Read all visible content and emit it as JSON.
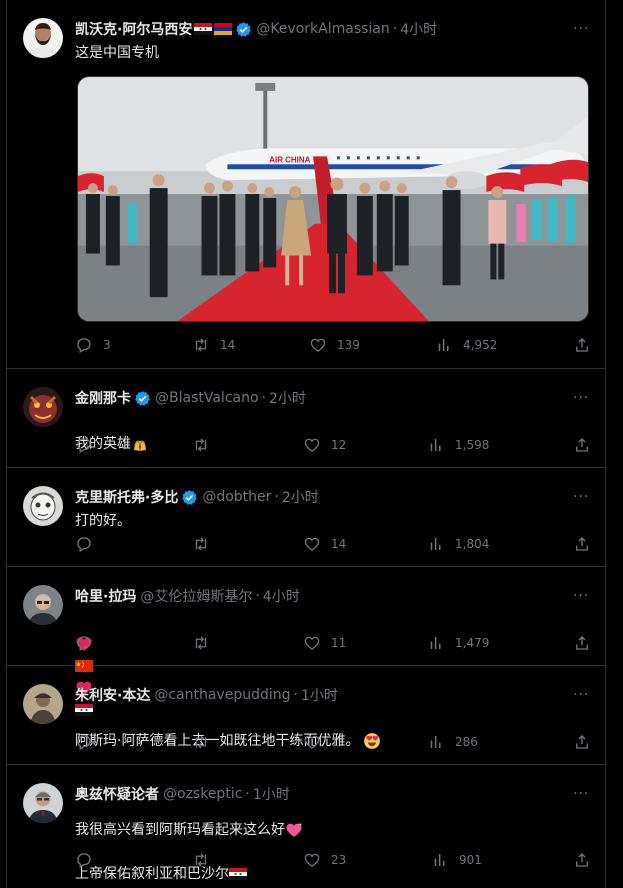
{
  "tweets": [
    {
      "name": "凯沃克·阿尔马西安",
      "handle": "@KevorkAlmassian",
      "time": "4小时",
      "text": "这是中国专机",
      "replies": "3",
      "retweets": "14",
      "likes": "139",
      "views": "4,952",
      "plane_livery": "AIR CHINA"
    },
    {
      "name": "金刚那卡",
      "handle": "@BlastValcano",
      "time": "2小时",
      "text": "我的英雄",
      "replies": "",
      "retweets": "",
      "likes": "12",
      "views": "1,598"
    },
    {
      "name": "克里斯托弗·多比",
      "handle": "@dobther",
      "time": "2小时",
      "text": "打的好。",
      "replies": "",
      "retweets": "",
      "likes": "14",
      "views": "1,804"
    },
    {
      "name": "哈里·拉玛",
      "handle": "@艾伦拉姆斯基尔",
      "time": "4小时",
      "text": "",
      "replies": "",
      "retweets": "",
      "likes": "11",
      "views": "1,479"
    },
    {
      "name": "朱利安·本达",
      "handle": "@canthavepudding",
      "time": "1小时",
      "text": "阿斯玛·阿萨德看上去一如既往地干练而优雅。",
      "replies": "",
      "retweets": "",
      "likes": "1",
      "views": "286"
    },
    {
      "name": "奥兹怀疑论者",
      "handle": "@ozskeptic",
      "time": "1小时",
      "text": "我很高兴看到阿斯玛看起来这么好",
      "text2": "上帝保佑叙利亚和巴沙尔",
      "replies": "",
      "retweets": "",
      "likes": "23",
      "views": "901"
    }
  ],
  "colors": {
    "background": "#000000",
    "text": "#e7e9ea",
    "muted": "#71767b",
    "border": "#2f3336",
    "verified": "#1d9bf0",
    "carpet": "#d8242f"
  }
}
